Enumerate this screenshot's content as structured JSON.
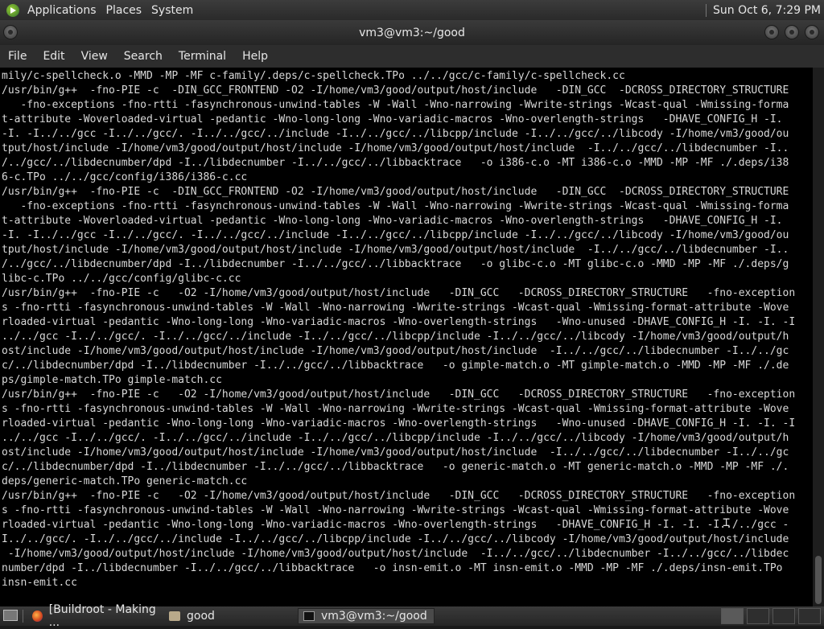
{
  "top_panel": {
    "menu": [
      "Applications",
      "Places",
      "System"
    ],
    "clock": "Sun Oct  6,  7:29 PM"
  },
  "window": {
    "title": "vm3@vm3:~/good",
    "menu": [
      "File",
      "Edit",
      "View",
      "Search",
      "Terminal",
      "Help"
    ]
  },
  "terminal": {
    "lines": [
      "mily/c-spellcheck.o -MMD -MP -MF c-family/.deps/c-spellcheck.TPo ../../gcc/c-family/c-spellcheck.cc",
      "/usr/bin/g++  -fno-PIE -c  -DIN_GCC_FRONTEND -O2 -I/home/vm3/good/output/host/include   -DIN_GCC  -DCROSS_DIRECTORY_STRUCTURE",
      "   -fno-exceptions -fno-rtti -fasynchronous-unwind-tables -W -Wall -Wno-narrowing -Wwrite-strings -Wcast-qual -Wmissing-forma",
      "t-attribute -Woverloaded-virtual -pedantic -Wno-long-long -Wno-variadic-macros -Wno-overlength-strings   -DHAVE_CONFIG_H -I.",
      "-I. -I../../gcc -I../../gcc/. -I../../gcc/../include -I../../gcc/../libcpp/include -I../../gcc/../libcody -I/home/vm3/good/ou",
      "tput/host/include -I/home/vm3/good/output/host/include -I/home/vm3/good/output/host/include  -I../../gcc/../libdecnumber -I..",
      "/../gcc/../libdecnumber/dpd -I../libdecnumber -I../../gcc/../libbacktrace   -o i386-c.o -MT i386-c.o -MMD -MP -MF ./.deps/i38",
      "6-c.TPo ../../gcc/config/i386/i386-c.cc",
      "/usr/bin/g++  -fno-PIE -c  -DIN_GCC_FRONTEND -O2 -I/home/vm3/good/output/host/include   -DIN_GCC  -DCROSS_DIRECTORY_STRUCTURE",
      "   -fno-exceptions -fno-rtti -fasynchronous-unwind-tables -W -Wall -Wno-narrowing -Wwrite-strings -Wcast-qual -Wmissing-forma",
      "t-attribute -Woverloaded-virtual -pedantic -Wno-long-long -Wno-variadic-macros -Wno-overlength-strings   -DHAVE_CONFIG_H -I.",
      "-I. -I../../gcc -I../../gcc/. -I../../gcc/../include -I../../gcc/../libcpp/include -I../../gcc/../libcody -I/home/vm3/good/ou",
      "tput/host/include -I/home/vm3/good/output/host/include -I/home/vm3/good/output/host/include  -I../../gcc/../libdecnumber -I..",
      "/../gcc/../libdecnumber/dpd -I../libdecnumber -I../../gcc/../libbacktrace   -o glibc-c.o -MT glibc-c.o -MMD -MP -MF ./.deps/g",
      "libc-c.TPo ../../gcc/config/glibc-c.cc",
      "/usr/bin/g++  -fno-PIE -c   -O2 -I/home/vm3/good/output/host/include   -DIN_GCC   -DCROSS_DIRECTORY_STRUCTURE   -fno-exception",
      "s -fno-rtti -fasynchronous-unwind-tables -W -Wall -Wno-narrowing -Wwrite-strings -Wcast-qual -Wmissing-format-attribute -Wove",
      "rloaded-virtual -pedantic -Wno-long-long -Wno-variadic-macros -Wno-overlength-strings   -Wno-unused -DHAVE_CONFIG_H -I. -I. -I",
      "../../gcc -I../../gcc/. -I../../gcc/../include -I../../gcc/../libcpp/include -I../../gcc/../libcody -I/home/vm3/good/output/h",
      "ost/include -I/home/vm3/good/output/host/include -I/home/vm3/good/output/host/include  -I../../gcc/../libdecnumber -I../../gc",
      "c/../libdecnumber/dpd -I../libdecnumber -I../../gcc/../libbacktrace   -o gimple-match.o -MT gimple-match.o -MMD -MP -MF ./.de",
      "ps/gimple-match.TPo gimple-match.cc",
      "/usr/bin/g++  -fno-PIE -c   -O2 -I/home/vm3/good/output/host/include   -DIN_GCC   -DCROSS_DIRECTORY_STRUCTURE   -fno-exception",
      "s -fno-rtti -fasynchronous-unwind-tables -W -Wall -Wno-narrowing -Wwrite-strings -Wcast-qual -Wmissing-format-attribute -Wove",
      "rloaded-virtual -pedantic -Wno-long-long -Wno-variadic-macros -Wno-overlength-strings   -Wno-unused -DHAVE_CONFIG_H -I. -I. -I",
      "../../gcc -I../../gcc/. -I../../gcc/../include -I../../gcc/../libcpp/include -I../../gcc/../libcody -I/home/vm3/good/output/h",
      "ost/include -I/home/vm3/good/output/host/include -I/home/vm3/good/output/host/include  -I../../gcc/../libdecnumber -I../../gc",
      "c/../libdecnumber/dpd -I../libdecnumber -I../../gcc/../libbacktrace   -o generic-match.o -MT generic-match.o -MMD -MP -MF ./.",
      "deps/generic-match.TPo generic-match.cc",
      "/usr/bin/g++  -fno-PIE -c   -O2 -I/home/vm3/good/output/host/include   -DIN_GCC   -DCROSS_DIRECTORY_STRUCTURE   -fno-exception",
      "s -fno-rtti -fasynchronous-unwind-tables -W -Wall -Wno-narrowing -Wwrite-strings -Wcast-qual -Wmissing-format-attribute -Wove",
      "rloaded-virtual -pedantic -Wno-long-long -Wno-variadic-macros -Wno-overlength-strings   -DHAVE_CONFIG_H -I. -I. -I../../gcc -",
      "I../../gcc/. -I../../gcc/../include -I../../gcc/../libcpp/include -I../../gcc/../libcody -I/home/vm3/good/output/host/include",
      " -I/home/vm3/good/output/host/include -I/home/vm3/good/output/host/include  -I../../gcc/../libdecnumber -I../../gcc/../libdec",
      "number/dpd -I../libdecnumber -I../../gcc/../libbacktrace   -o insn-emit.o -MT insn-emit.o -MMD -MP -MF ./.deps/insn-emit.TPo",
      "insn-emit.cc"
    ]
  },
  "taskbar": {
    "tasks": [
      {
        "label": "[Buildroot - Making ...",
        "icon": "firefox-icon"
      },
      {
        "label": "good",
        "icon": "folder-icon"
      },
      {
        "label": "vm3@vm3:~/good",
        "icon": "terminal-icon"
      }
    ]
  }
}
